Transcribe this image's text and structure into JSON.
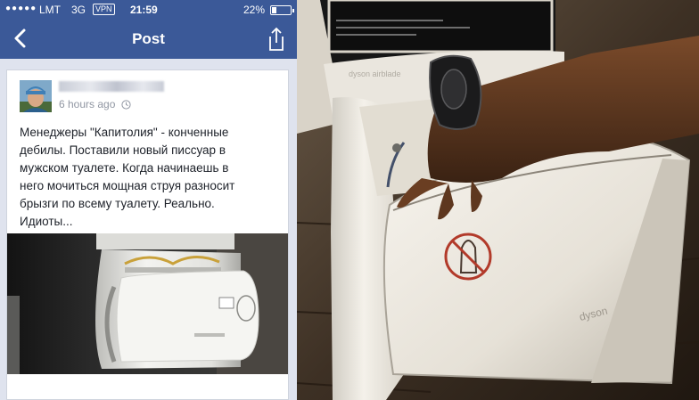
{
  "status_bar": {
    "signal": "●●●●●",
    "carrier": "LMT",
    "network": "3G",
    "vpn": "VPN",
    "time": "21:59",
    "battery": "22%",
    "battery_level": 0.22
  },
  "nav_bar": {
    "title": "Post"
  },
  "post": {
    "timestamp": "6 hours ago",
    "text": "Менеджеры \"Капитолия\" - конченные\nдебилы. Поставили новый писсуар в\nмужском туалете. Когда начинаешь в\nнего мочиться мощная струя разносит\nбрызги по всему туалету. Реально.\nИдиоты..."
  },
  "photo_right": {
    "brand": "dyson",
    "model_label": "dyson airblade"
  },
  "icons": [
    "back-arrow-icon",
    "share-icon",
    "clock-icon",
    "battery-icon"
  ],
  "colors": {
    "facebook_blue": "#3b5998",
    "card_bg": "#ffffff",
    "feed_bg": "#dfe3ee",
    "meta_gray": "#9197a3"
  }
}
